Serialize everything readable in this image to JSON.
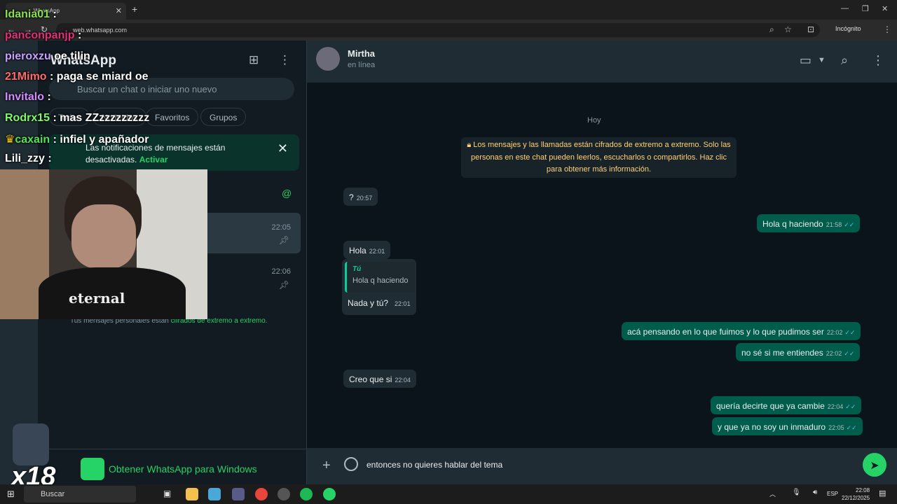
{
  "browser": {
    "tab_title": "WhatsApp",
    "url": "web.whatsapp.com",
    "profile_label": "Incógnito"
  },
  "sidebar": {
    "app_title": "WhatsApp",
    "search_placeholder": "Buscar un chat o iniciar uno nuevo",
    "filters": [
      "Todos",
      "No leídos",
      "Favoritos",
      "Grupos"
    ],
    "notification": {
      "text": "Las notificaciones de mensajes están desactivadas.",
      "action": "Activar"
    },
    "chats": [
      {
        "time": "22:05",
        "pinned": true
      },
      {
        "time": "22:06",
        "pinned": true
      }
    ],
    "encryption_footer": "Tus mensajes personales están",
    "encryption_footer_link": "cifrados de extremo a extremo.",
    "get_app_label": "Obtener WhatsApp para Windows"
  },
  "conversation": {
    "contact_name": "Mirtha",
    "contact_status": "en línea",
    "date_chip": "Hoy",
    "encryption_notice": "Los mensajes y las llamadas están cifrados de extremo a extremo. Solo las personas en este chat pueden leerlos, escucharlos o compartirlos. Haz clic para obtener más información.",
    "messages": [
      {
        "dir": "in",
        "text": "?",
        "time": "20:57"
      },
      {
        "dir": "out",
        "text": "Hola q haciendo",
        "time": "21:58"
      },
      {
        "dir": "in",
        "text": "Hola",
        "time": "22:01"
      },
      {
        "dir": "in",
        "reply_author": "Tú",
        "reply_text": "Hola q haciendo",
        "text": "Nada y tú?",
        "time": "22:01"
      },
      {
        "dir": "out",
        "text": "acá pensando en lo que fuimos y lo que pudimos ser",
        "time": "22:02"
      },
      {
        "dir": "out",
        "text": "no sé si me entiendes",
        "time": "22:02"
      },
      {
        "dir": "in",
        "text": "Creo que si",
        "time": "22:04"
      },
      {
        "dir": "out",
        "text": "quería decirte que ya cambie",
        "time": "22:04"
      },
      {
        "dir": "out",
        "text": "y que ya no soy un inmaduro",
        "time": "22:05"
      }
    ],
    "draft": "entonces no quieres hablar del tema"
  },
  "overlay_chat": [
    {
      "user": "Idania01",
      "msg": ":",
      "color": "#8be04e"
    },
    {
      "user": "panconpanjp",
      "msg": ":",
      "color": "#e0307a"
    },
    {
      "user": "pieroxzu",
      "msg": "oe tilin",
      "color": "#c9a0ff"
    },
    {
      "user": "21Mimo",
      "msg": ": paga se miard oe",
      "color": "#ff6b6b"
    },
    {
      "user": "Invitalo",
      "msg": ":",
      "color": "#d38cff"
    },
    {
      "user": "Rodrx15",
      "msg": ": mas ZZzzzzzzzzz",
      "color": "#7cfc6a"
    },
    {
      "user": "caxain",
      "msg": ": infiel y apañador",
      "color": "#58e05a"
    },
    {
      "user": "Lili_zzy",
      "msg": ":",
      "color": "#ffffff"
    }
  ],
  "webcam_shirt_text": "eternal",
  "overlay_badge": "x18",
  "taskbar": {
    "search_label": "Buscar",
    "language": "ESP",
    "time": "22:08",
    "date": "22/12/2025"
  },
  "colors": {
    "accent": "#25d366",
    "bubble_out": "#005c4b",
    "bubble_in": "#202c33",
    "panel": "#111b21",
    "chat_bg": "#0b141a"
  }
}
